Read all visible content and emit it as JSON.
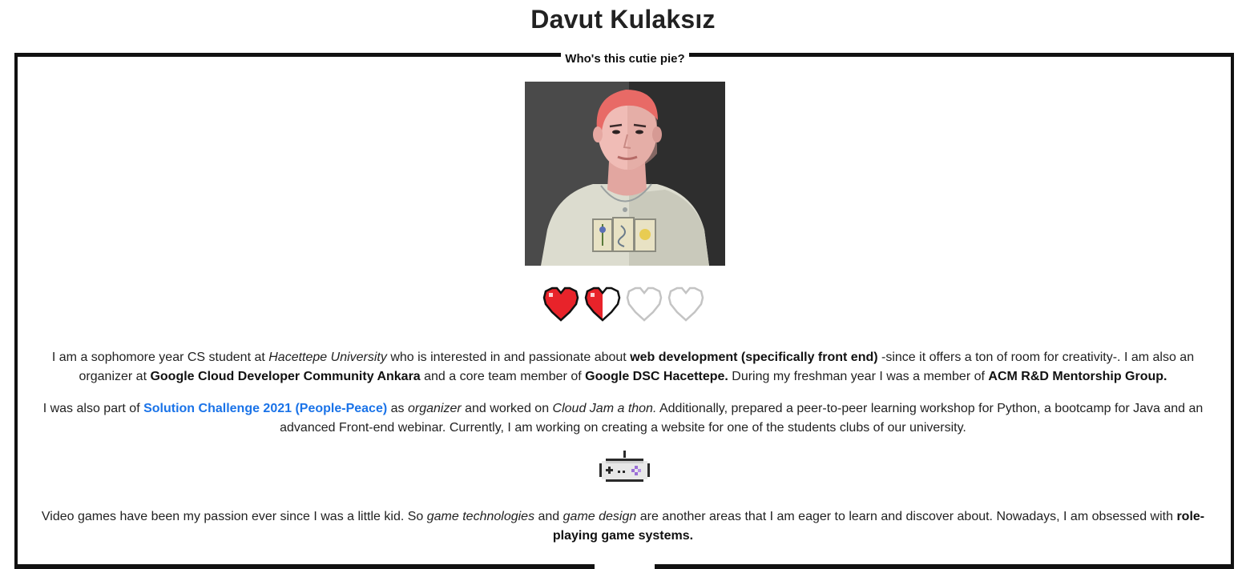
{
  "page": {
    "title": "Davut Kulaksız"
  },
  "section": {
    "legend": "Who's this cutie pie?"
  },
  "hearts": {
    "rating": 1.5,
    "max": 4,
    "colors": {
      "filled": "#e8232a",
      "outline": "#111111",
      "empty_outline": "#c4c4c4"
    }
  },
  "about": {
    "p1": {
      "t1": "I am a sophomore year CS student at ",
      "t2": "Hacettepe University",
      "t3": " who is interested in and passionate about ",
      "t4": "web development (specifically front end)",
      "t5": " -since it offers a ton of room for creativity-. I am also an organizer at ",
      "t6": "Google Cloud Developer Community Ankara",
      "t7": " and a core team member of ",
      "t8": "Google DSC Hacettepe.",
      "t9": " During my freshman year I was a member of ",
      "t10": "ACM R&D Mentorship Group."
    },
    "p2": {
      "t1": "I was also part of ",
      "link": "Solution Challenge 2021 (People-Peace)",
      "t2": " as ",
      "t3": "organizer",
      "t4": " and worked on ",
      "t5": "Cloud Jam a thon.",
      "t6": " Additionally, prepared a peer-to-peer learning workshop for Python, a bootcamp for Java and an advanced Front-end webinar. Currently, I am working on creating a website for one of the students clubs of our university."
    },
    "p3": {
      "t1": "Video games have been my passion ever since I was a little kid. So ",
      "t2": "game technologies",
      "t3": " and ",
      "t4": "game design",
      "t5": " are another areas that I am eager to learn and discover about. Nowadays, I am obsessed with ",
      "t6": "role-playing game systems."
    }
  },
  "colors": {
    "link": "#1a73e8",
    "frame": "#111111",
    "text": "#222222"
  }
}
